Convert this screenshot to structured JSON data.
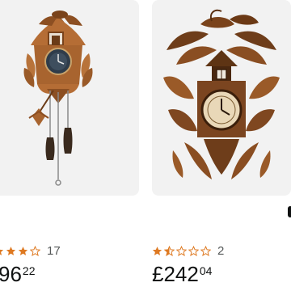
{
  "products": [
    {
      "image_alt": "Carved wooden cuckoo clock with pendulum and pine cone weights",
      "rating_count": "17",
      "rating_value": 3.5,
      "price_symbol": "",
      "price_whole": "96",
      "price_fraction": "22"
    },
    {
      "image_alt": "Black Forest hand-carved cuckoo clock with leaves and birds",
      "rating_count": "2",
      "rating_value": 1.5,
      "price_symbol": "£",
      "price_whole": "242",
      "price_fraction": "04"
    }
  ],
  "colors": {
    "star_fill": "#de7921",
    "star_outline": "#de7921",
    "tile_background": "#f2f2f2",
    "price_text": "#0f1111",
    "rating_text": "#565959"
  }
}
